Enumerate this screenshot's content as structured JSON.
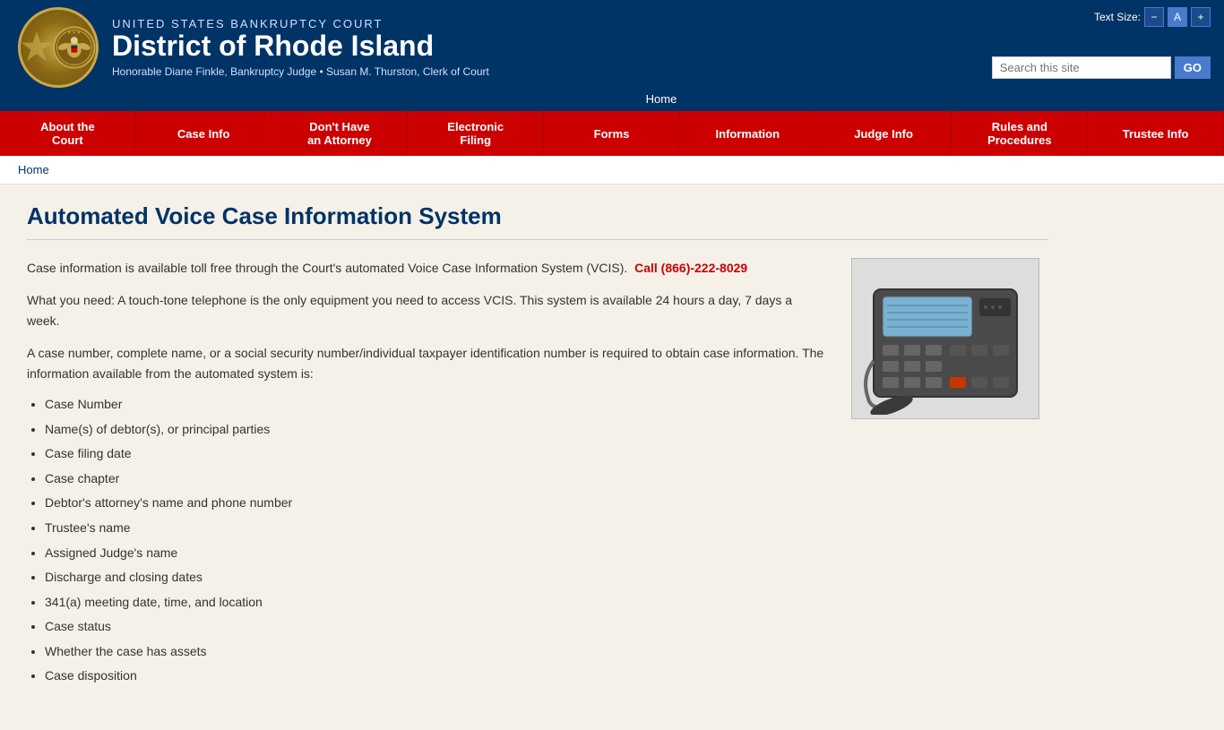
{
  "textSize": {
    "label": "Text Size:",
    "decrease": "−",
    "current": "A",
    "increase": "+"
  },
  "header": {
    "subtitle": "UNITED STATES BANKRUPTCY COURT",
    "title": "District of Rhode Island",
    "judges": "Honorable Diane Finkle, Bankruptcy Judge • Susan M. Thurston, Clerk of Court"
  },
  "search": {
    "placeholder": "Search this site",
    "button": "GO"
  },
  "homeNav": {
    "label": "Home"
  },
  "nav": {
    "items": [
      {
        "label": "About the\nCourt",
        "active": false
      },
      {
        "label": "Case Info",
        "active": false
      },
      {
        "label": "Don't Have\nan Attorney",
        "active": false
      },
      {
        "label": "Electronic\nFiling",
        "active": false
      },
      {
        "label": "Forms",
        "active": false
      },
      {
        "label": "Information",
        "active": false
      },
      {
        "label": "Judge Info",
        "active": false
      },
      {
        "label": "Rules and\nProcedures",
        "active": false
      },
      {
        "label": "Trustee Info",
        "active": false
      }
    ]
  },
  "breadcrumb": {
    "home": "Home"
  },
  "page": {
    "title": "Automated Voice Case Information System",
    "paragraphs": [
      "Case information is available toll free through the Court's automated Voice Case Information System (VCIS).",
      "What you need: A touch-tone telephone is the only equipment you need to access VCIS.  This system is available 24 hours a day, 7 days a week.",
      "A case number, complete name, or a social security number/individual taxpayer identification number is required to obtain case information. The information available from the automated system is:"
    ],
    "phone": "Call (866)-222-8029",
    "listItems": [
      "Case Number",
      "Name(s) of debtor(s), or principal parties",
      "Case filing date",
      "Case chapter",
      "Debtor's attorney's name and phone number",
      "Trustee's name",
      "Assigned Judge's name",
      "Discharge and closing dates",
      "341(a) meeting date, time, and location",
      "Case status",
      "Whether the case has assets",
      "Case disposition"
    ]
  }
}
